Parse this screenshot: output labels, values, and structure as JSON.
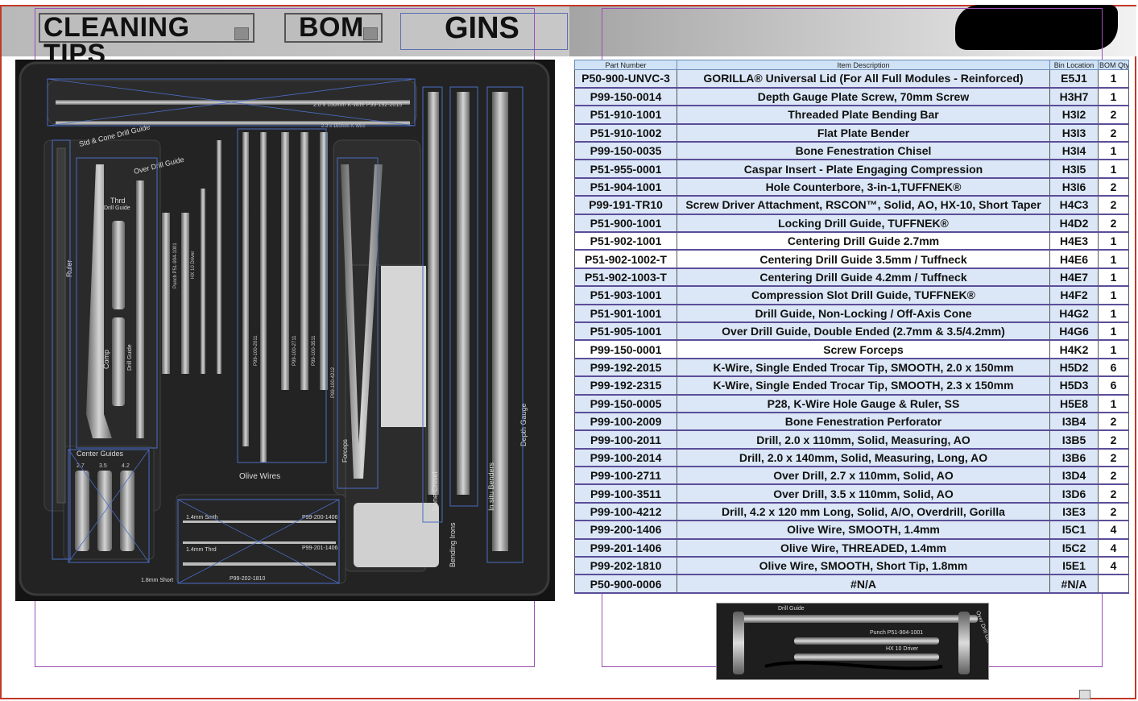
{
  "header": {
    "cleaning_label": "CLEANING TIPS",
    "bom_label": "BOM",
    "title": "GINS"
  },
  "bom": {
    "columns": [
      "Part Number",
      "Item Description",
      "Bin Location",
      "BOM Qty"
    ],
    "rows": [
      {
        "part": "P50-900-UNVC-3",
        "desc": "GORILLA® Universal Lid (For All Full Modules - Reinforced)",
        "bin": "E5J1",
        "qty": "1"
      },
      {
        "part": "P99-150-0014",
        "desc": "Depth Gauge Plate Screw, 70mm Screw",
        "bin": "H3H7",
        "qty": "1"
      },
      {
        "part": "P51-910-1001",
        "desc": "Threaded Plate Bending Bar",
        "bin": "H3I2",
        "qty": "2"
      },
      {
        "part": "P51-910-1002",
        "desc": "Flat Plate Bender",
        "bin": "H3I3",
        "qty": "2"
      },
      {
        "part": "P99-150-0035",
        "desc": "Bone Fenestration Chisel",
        "bin": "H3I4",
        "qty": "1"
      },
      {
        "part": "P51-955-0001",
        "desc": "Caspar Insert - Plate Engaging Compression",
        "bin": "H3I5",
        "qty": "1"
      },
      {
        "part": "P51-904-1001",
        "desc": "Hole Counterbore, 3-in-1,TUFFNEK®",
        "bin": "H3I6",
        "qty": "2"
      },
      {
        "part": "P99-191-TR10",
        "desc": "Screw Driver Attachment, RSCON™, Solid, AO, HX-10, Short Taper",
        "bin": "H4C3",
        "qty": "2"
      },
      {
        "part": "P51-900-1001",
        "desc": "Locking Drill Guide, TUFFNEK®",
        "bin": "H4D2",
        "qty": "2"
      },
      {
        "part": "P51-902-1001",
        "desc": "Centering Drill Guide 2.7mm",
        "bin": "H4E3",
        "qty": "1"
      },
      {
        "part": "P51-902-1002-T",
        "desc": "Centering Drill Guide 3.5mm / Tuffneck",
        "bin": "H4E6",
        "qty": "1"
      },
      {
        "part": "P51-902-1003-T",
        "desc": "Centering Drill Guide 4.2mm / Tuffneck",
        "bin": "H4E7",
        "qty": "1"
      },
      {
        "part": "P51-903-1001",
        "desc": "Compression Slot Drill Guide, TUFFNEK®",
        "bin": "H4F2",
        "qty": "1"
      },
      {
        "part": "P51-901-1001",
        "desc": "Drill Guide, Non-Locking / Off-Axis Cone",
        "bin": "H4G2",
        "qty": "1"
      },
      {
        "part": "P51-905-1001",
        "desc": "Over Drill Guide, Double Ended (2.7mm & 3.5/4.2mm)",
        "bin": "H4G6",
        "qty": "1"
      },
      {
        "part": "P99-150-0001",
        "desc": "Screw Forceps",
        "bin": "H4K2",
        "qty": "1"
      },
      {
        "part": "P99-192-2015",
        "desc": "K-Wire, Single Ended Trocar Tip, SMOOTH, 2.0 x 150mm",
        "bin": "H5D2",
        "qty": "6"
      },
      {
        "part": "P99-192-2315",
        "desc": "K-Wire, Single Ended Trocar Tip, SMOOTH, 2.3 x 150mm",
        "bin": "H5D3",
        "qty": "6"
      },
      {
        "part": "P99-150-0005",
        "desc": "P28, K-Wire Hole Gauge & Ruler, SS",
        "bin": "H5E8",
        "qty": "1"
      },
      {
        "part": "P99-100-2009",
        "desc": "Bone Fenestration Perforator",
        "bin": "I3B4",
        "qty": "2"
      },
      {
        "part": "P99-100-2011",
        "desc": "Drill, 2.0 x 110mm, Solid, Measuring, AO",
        "bin": "I3B5",
        "qty": "2"
      },
      {
        "part": "P99-100-2014",
        "desc": "Drill,  2.0 x 140mm, Solid, Measuring, Long, AO",
        "bin": "I3B6",
        "qty": "2"
      },
      {
        "part": "P99-100-2711",
        "desc": "Over Drill, 2.7 x 110mm, Solid, AO",
        "bin": "I3D4",
        "qty": "2"
      },
      {
        "part": "P99-100-3511",
        "desc": "Over Drill, 3.5 x 110mm, Solid, AO",
        "bin": "I3D6",
        "qty": "2"
      },
      {
        "part": "P99-100-4212",
        "desc": "Drill, 4.2 x 120 mm Long, Solid, A/O, Overdrill, Gorilla",
        "bin": "I3E3",
        "qty": "2"
      },
      {
        "part": "P99-200-1406",
        "desc": "Olive Wire, SMOOTH, 1.4mm",
        "bin": "I5C1",
        "qty": "4"
      },
      {
        "part": "P99-201-1406",
        "desc": "Olive Wire, THREADED, 1.4mm",
        "bin": "I5C2",
        "qty": "4"
      },
      {
        "part": "P99-202-1810",
        "desc": "Olive Wire, SMOOTH, Short Tip, 1.8mm",
        "bin": "I5E1",
        "qty": "4"
      },
      {
        "part": "P50-900-0006",
        "desc": "#N/A",
        "bin": "#N/A",
        "qty": ""
      }
    ]
  },
  "tray": {
    "labels": {
      "kwire_top": "2.0 x 150mm K-Wire  P99-192-2015",
      "kwire_2": "2.3 x 150mm K-Wire",
      "std_cone": "Std & Cone Drill Guide",
      "over_drill_guide": "Over Drill Guide",
      "thrd": "Thrd",
      "drill_guide": "Drill Guide",
      "ruler": "Ruler",
      "comp": "Comp",
      "comp_drill_guide": "Drill Guide",
      "punch": "Punch P51-904-1001",
      "hx10": "HX 10 Driver",
      "center_guides": "Center Guides",
      "olive_wires": "Olive Wires",
      "forceps": "Forceps",
      "bone_chisel": "Bone Chisel",
      "bending_irons": "Bending Irons",
      "in_situ_benders": "In situ Benders",
      "depth_gauge": "Depth Gauge",
      "smth14": "1.4mm Smth",
      "thrd14": "1.4mm Thrd",
      "short18": "1.8mm Short",
      "p1406a": "P99-200-1406",
      "p1406b": "P99-201-1406",
      "p1810": "P99-202-1810",
      "cg1": "2.7",
      "cg2": "3.5",
      "cg3": "4.2",
      "d2011": "P99-100-2011",
      "d2711": "P99-100-2711",
      "d3511": "P99-100-3511",
      "d4212": "P99-100-4212"
    }
  },
  "thumb": {
    "labels": {
      "drill_guide": "Drill Guide",
      "punch": "Punch  P51-904-1001",
      "hx10": "HX 10 Driver",
      "over_drill_guide": "Over Drill Guide"
    }
  },
  "colors": {
    "row_highlight": "#dbe7f6",
    "row_border": "#5b4e98",
    "frame_red": "#c0392b",
    "guide_purple": "#9a4fb5"
  }
}
